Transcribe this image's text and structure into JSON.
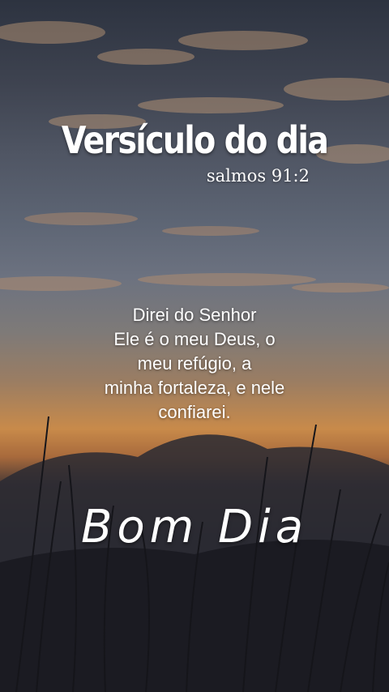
{
  "title": "Versículo do dia",
  "reference": "salmos 91:2",
  "verse_lines": [
    "Direi do Senhor",
    "Ele é o meu Deus, o",
    "meu refúgio, a",
    "minha fortaleza, e nele",
    "confiarei."
  ],
  "greeting": "Bom Dia"
}
